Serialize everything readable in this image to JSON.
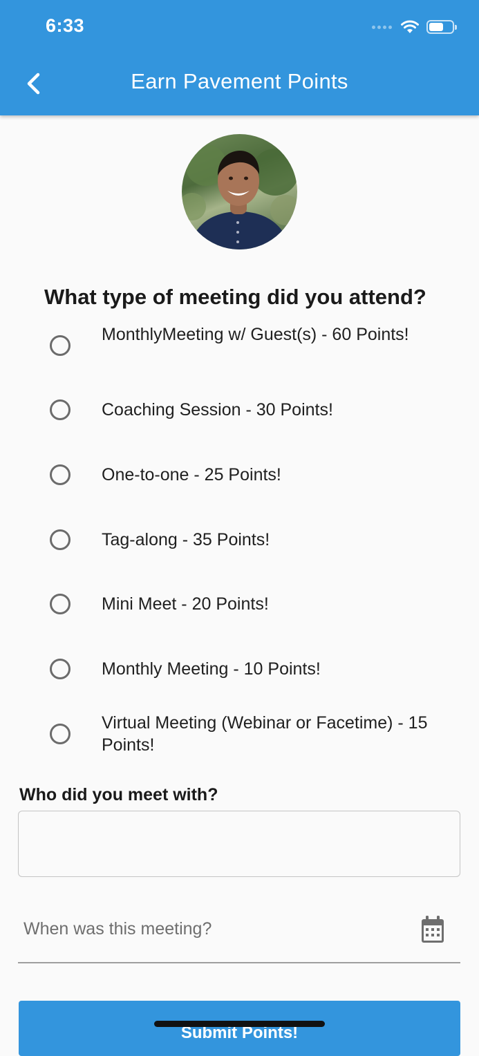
{
  "status_bar": {
    "time": "6:33"
  },
  "header": {
    "title": "Earn Pavement Points",
    "back_icon": "chevron-left-icon"
  },
  "question": "What type of meeting did you attend?",
  "options": [
    {
      "label": "MonthlyMeeting w/ Guest(s) - 60 Points!",
      "selected": false
    },
    {
      "label": "Coaching Session - 30 Points!",
      "selected": false
    },
    {
      "label": "One-to-one - 25 Points!",
      "selected": false
    },
    {
      "label": "Tag-along - 35 Points!",
      "selected": false
    },
    {
      "label": "Mini Meet - 20 Points!",
      "selected": false
    },
    {
      "label": "Monthly Meeting - 10 Points!",
      "selected": false
    },
    {
      "label": "Virtual Meeting (Webinar or Facetime) - 15 Points!",
      "selected": false
    }
  ],
  "who_field": {
    "label": "Who did you meet with?",
    "value": ""
  },
  "date_field": {
    "placeholder": "When was this meeting?",
    "icon": "calendar-icon"
  },
  "submit": {
    "label": "Submit Points!"
  },
  "colors": {
    "primary": "#3395dd",
    "background": "#fafafa",
    "radio": "#6b6b6b"
  }
}
